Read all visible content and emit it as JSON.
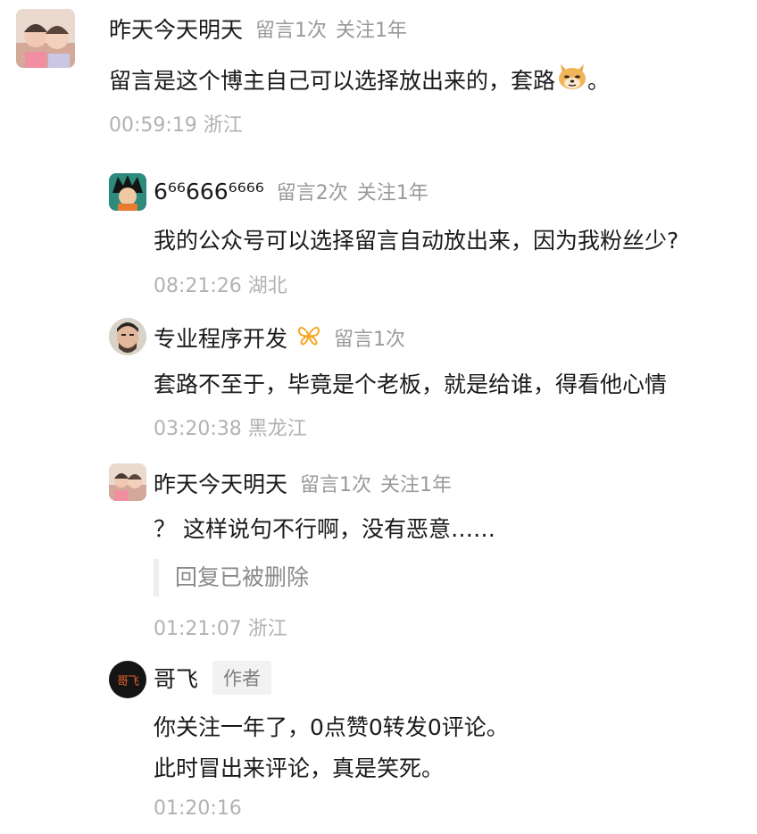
{
  "comments": [
    {
      "name": "昨天今天明天",
      "meta": [
        "留言1次",
        "关注1年"
      ],
      "body": "留言是这个博主自己可以选择放出来的，套路",
      "body_suffix": "。",
      "emoji": "doge-icon",
      "time": "00:59:19 浙江"
    }
  ],
  "replies": [
    {
      "name": "6⁶⁶666⁶⁶⁶⁶",
      "meta": [
        "留言2次",
        "关注1年"
      ],
      "body": "我的公众号可以选择留言自动放出来，因为我粉丝少?",
      "time": "08:21:26 湖北"
    },
    {
      "name": "专业程序开发",
      "badge_icon": "verified-butterfly-icon",
      "badge_color": "#f5a623",
      "meta": [
        "留言1次"
      ],
      "body": "套路不至于，毕竟是个老板，就是给谁，得看他心情",
      "time": "03:20:38 黑龙江"
    },
    {
      "name": "昨天今天明天",
      "meta": [
        "留言1次",
        "关注1年"
      ],
      "body": "？ 这样说句不行啊，没有恶意……",
      "quote": "回复已被删除",
      "time": "01:21:07 浙江"
    },
    {
      "name": "哥飞",
      "tag": "作者",
      "avatar_text": "哥飞",
      "avatar_text_color": "#e8622c",
      "body_lines": [
        "你关注一年了，0点赞0转发0评论。",
        "此时冒出来评论，真是笑死。"
      ],
      "time": "01:20:16"
    }
  ]
}
